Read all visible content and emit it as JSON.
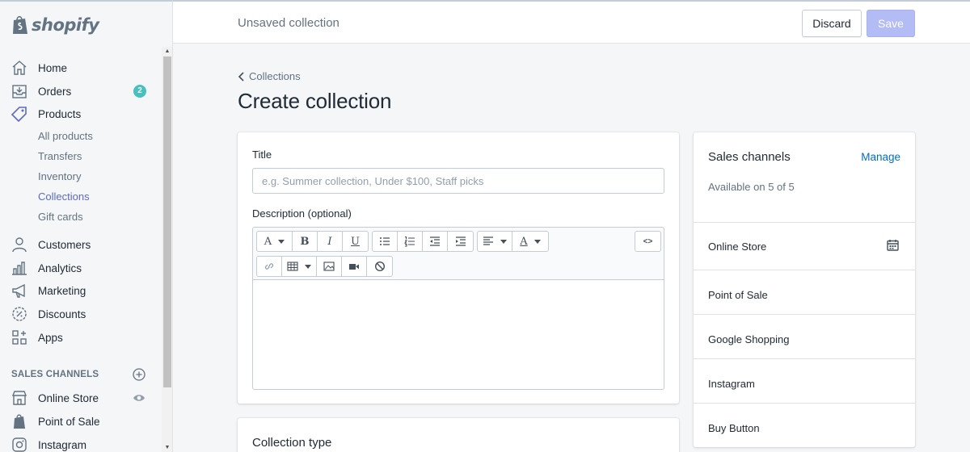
{
  "app": {
    "brand": "shopify"
  },
  "topbar": {
    "title": "Unsaved collection",
    "discard_label": "Discard",
    "save_label": "Save"
  },
  "sidebar": {
    "main": [
      {
        "label": "Home",
        "icon": "home-icon"
      },
      {
        "label": "Orders",
        "icon": "orders-icon",
        "badge": "2"
      },
      {
        "label": "Products",
        "icon": "tag-icon"
      }
    ],
    "product_sub": [
      "All products",
      "Transfers",
      "Inventory",
      "Collections",
      "Gift cards"
    ],
    "active_sub": "Collections",
    "more": [
      {
        "label": "Customers",
        "icon": "person-icon"
      },
      {
        "label": "Analytics",
        "icon": "bar-chart-icon"
      },
      {
        "label": "Marketing",
        "icon": "megaphone-icon"
      },
      {
        "label": "Discounts",
        "icon": "discount-icon"
      },
      {
        "label": "Apps",
        "icon": "apps-icon"
      }
    ],
    "section_title": "SALES CHANNELS",
    "channels": [
      {
        "label": "Online Store",
        "icon": "store-icon"
      },
      {
        "label": "Point of Sale",
        "icon": "pos-icon"
      },
      {
        "label": "Instagram",
        "icon": "instagram-icon"
      }
    ]
  },
  "page": {
    "breadcrumb": "Collections",
    "title": "Create collection"
  },
  "form": {
    "title_label": "Title",
    "title_placeholder": "e.g. Summer collection, Under $100, Staff picks",
    "description_label": "Description (optional)",
    "collection_type_title": "Collection type"
  },
  "sales_channels": {
    "title": "Sales channels",
    "manage_label": "Manage",
    "availability": "Available on 5 of 5",
    "channels": [
      "Online Store",
      "Point of Sale",
      "Google Shopping",
      "Instagram",
      "Buy Button"
    ]
  },
  "colors": {
    "accent": "#5c6ac4",
    "link": "#006fbb",
    "badge": "#47c1bf",
    "save_disabled": "#b3bcf5"
  }
}
